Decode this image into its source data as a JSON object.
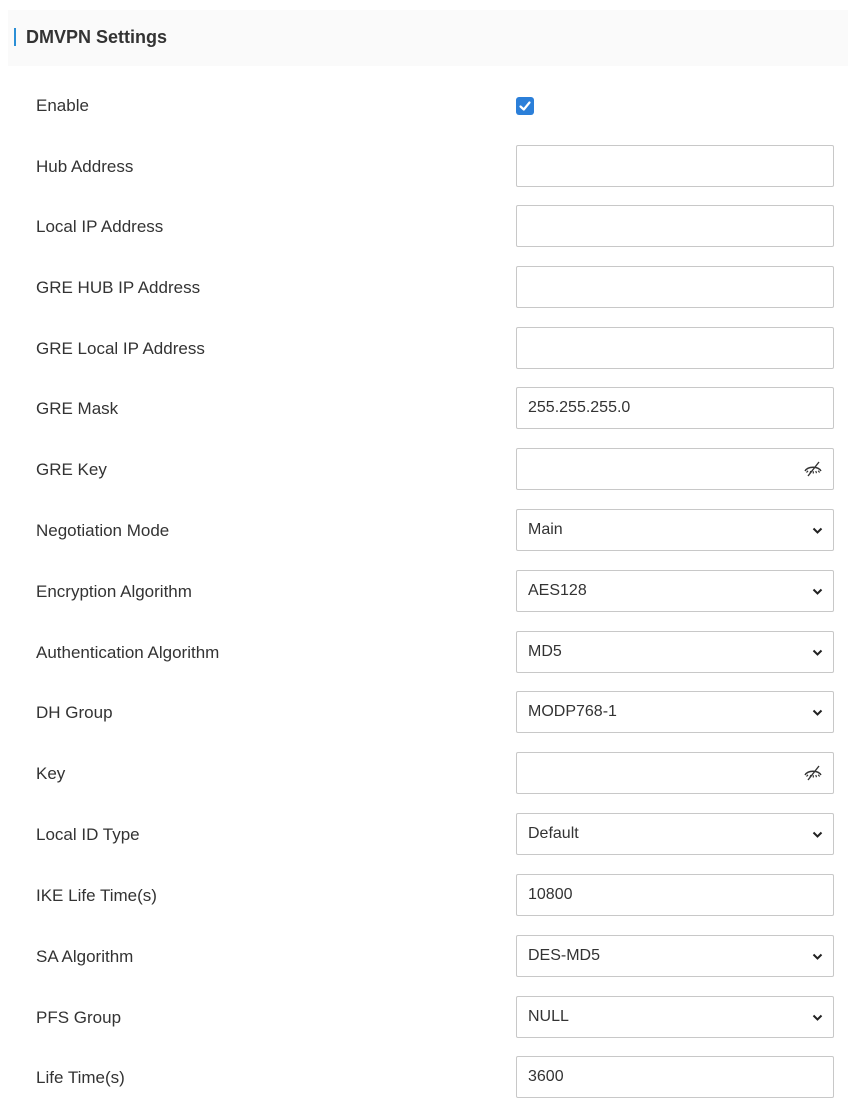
{
  "section": {
    "title": "DMVPN Settings"
  },
  "accent_color": "#2b8fd6",
  "fields": {
    "enable": {
      "label": "Enable",
      "checked": true
    },
    "hub_address": {
      "label": "Hub Address",
      "value": ""
    },
    "local_ip_address": {
      "label": "Local IP Address",
      "value": ""
    },
    "gre_hub_ip_address": {
      "label": "GRE HUB IP Address",
      "value": ""
    },
    "gre_local_ip_address": {
      "label": "GRE Local IP Address",
      "value": ""
    },
    "gre_mask": {
      "label": "GRE Mask",
      "value": "255.255.255.0"
    },
    "gre_key": {
      "label": "GRE Key",
      "value": "",
      "icon": "eye-slash-icon"
    },
    "negotiation_mode": {
      "label": "Negotiation Mode",
      "value": "Main"
    },
    "encryption_algorithm": {
      "label": "Encryption Algorithm",
      "value": "AES128"
    },
    "authentication_algorithm": {
      "label": "Authentication Algorithm",
      "value": "MD5"
    },
    "dh_group": {
      "label": "DH Group",
      "value": "MODP768-1"
    },
    "key": {
      "label": "Key",
      "value": "",
      "icon": "eye-slash-icon"
    },
    "local_id_type": {
      "label": "Local ID Type",
      "value": "Default"
    },
    "ike_life_time": {
      "label": "IKE Life Time(s)",
      "value": "10800"
    },
    "sa_algorithm": {
      "label": "SA Algorithm",
      "value": "DES-MD5"
    },
    "pfs_group": {
      "label": "PFS Group",
      "value": "NULL"
    },
    "life_time": {
      "label": "Life Time(s)",
      "value": "3600"
    }
  }
}
